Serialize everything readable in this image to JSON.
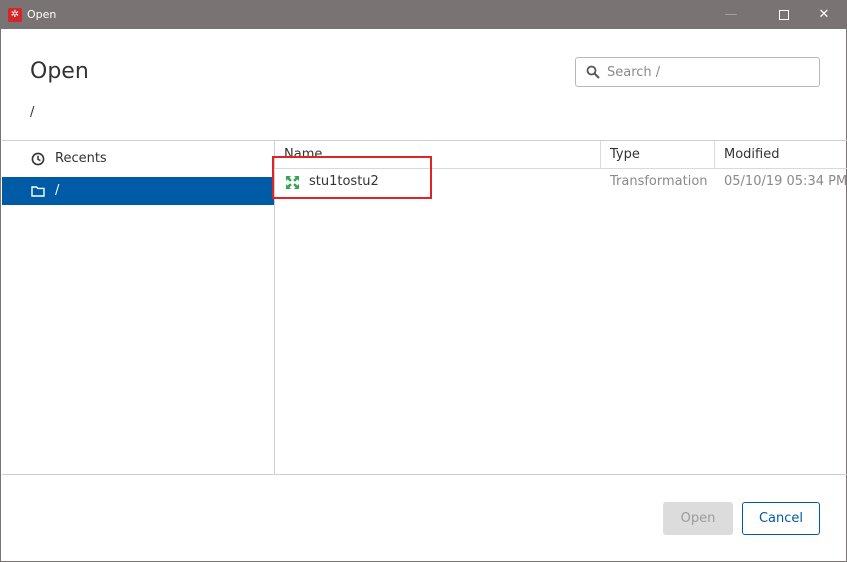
{
  "window": {
    "title": "Open",
    "app_icon": "pentaho-spoon-icon",
    "controls": {
      "minimize": "—",
      "close": "✕"
    }
  },
  "dialog": {
    "title": "Open",
    "current_path": "/"
  },
  "search": {
    "placeholder": "Search /",
    "value": ""
  },
  "sidebar": {
    "items": [
      {
        "label": "Recents",
        "icon": "clock-icon",
        "selected": false
      },
      {
        "label": "/",
        "icon": "folder-icon",
        "selected": true
      }
    ]
  },
  "file_list": {
    "columns": [
      "Name",
      "Type",
      "Modified"
    ],
    "rows": [
      {
        "name": "stu1tostu2",
        "type": "Transformation",
        "modified": "05/10/19 05:34 PM",
        "icon": "transformation-icon"
      }
    ]
  },
  "buttons": {
    "open": "Open",
    "cancel": "Cancel"
  },
  "colors": {
    "titlebar": "#7a7373",
    "selection": "#005ba6",
    "accent": "#005ba6",
    "highlight_annotation": "#e02424",
    "transformation_icon": "#2fa84f"
  }
}
